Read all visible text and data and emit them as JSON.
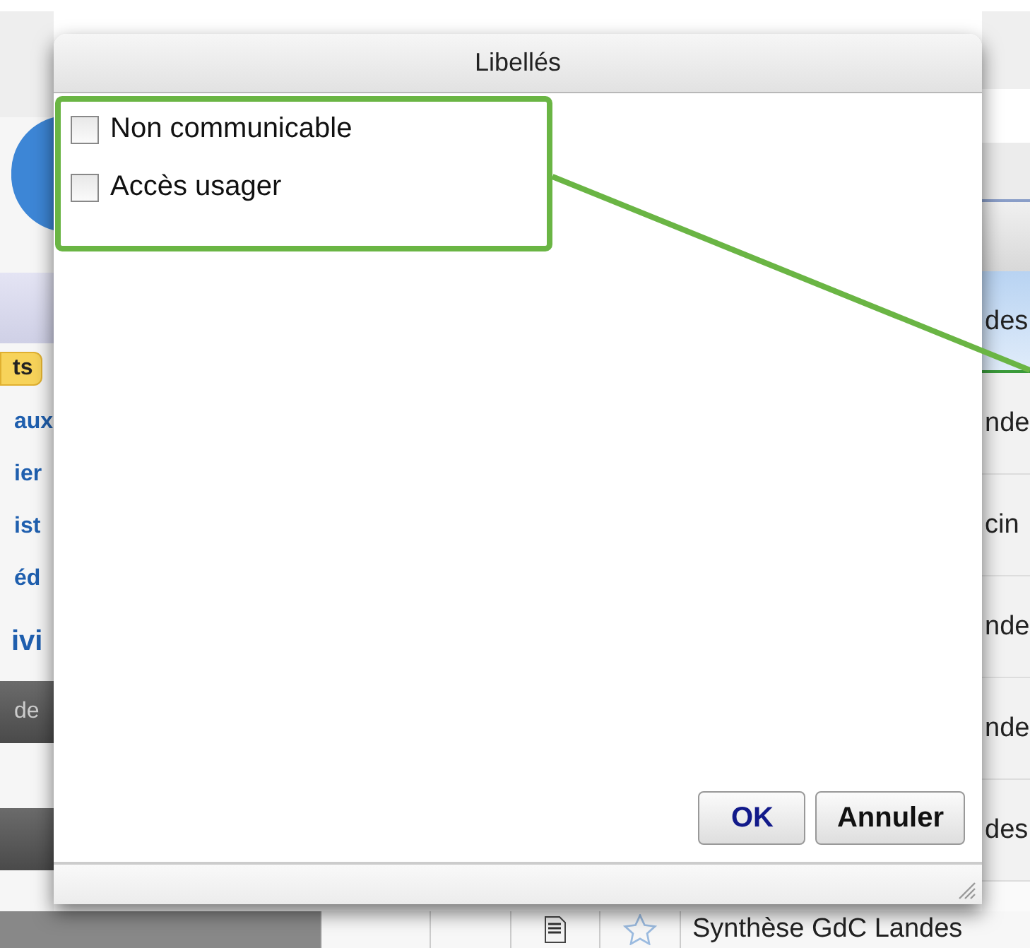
{
  "background": {
    "sidebar": {
      "badge": "ts",
      "links": [
        "aux",
        "ier",
        "ist",
        "éd"
      ],
      "heading": "ivi",
      "bar_label": "de"
    },
    "table": {
      "rows": [
        {
          "text": "des",
          "selected": true
        },
        {
          "text": "nde",
          "selected": false
        },
        {
          "text": "cin",
          "selected": false
        },
        {
          "text": "nde",
          "selected": false
        },
        {
          "text": "nde",
          "selected": false
        },
        {
          "text": "des",
          "selected": false
        }
      ],
      "bottom_row": "Synthèse GdC Landes"
    }
  },
  "dialog": {
    "title": "Libellés",
    "options": [
      {
        "label": "Non communicable",
        "checked": false
      },
      {
        "label": "Accès usager",
        "checked": false
      }
    ],
    "buttons": [
      {
        "label": "OK",
        "kind": "primary"
      },
      {
        "label": "Annuler",
        "kind": "secondary"
      }
    ]
  }
}
